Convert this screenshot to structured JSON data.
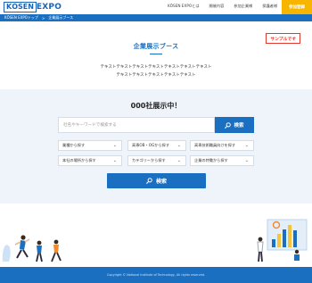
{
  "header": {
    "logo_bracket": "KŌSEN",
    "logo_text": " EXPO",
    "nav": [
      "KŌSEN EXPOとは",
      "開催内容",
      "参加企業様",
      "保護者様"
    ],
    "cta_label": "参加登録"
  },
  "breadcrumb": [
    "KŌSEN EXPOトップ",
    ">",
    "企業展示ブース"
  ],
  "sample_badge": "サンプルです",
  "page": {
    "title": "企業展示ブース",
    "desc_line1": "テキストテキストテキストテキストテキストテキストテキスト",
    "desc_line2": "テキストテキストテキストテキストテキスト"
  },
  "search": {
    "count_text": "000社展示中！",
    "keyword_placeholder": "社名やキーワードで検索する",
    "keyword_button": "検索",
    "selects": [
      "業種から探す",
      "高専OB・OGから探す",
      "高専技術職員向けを探す",
      "本社の場所から探す",
      "カテゴリーから探す",
      "企業の特徴から探す"
    ],
    "main_button": "検索"
  },
  "footer": {
    "copyright": "Copyright © National Institute of Technology, All rights reserved."
  },
  "colors": {
    "primary": "#1b6fc1",
    "accent": "#f7b500",
    "sample": "#e23b2e",
    "panel_bg": "#eef4fa"
  }
}
